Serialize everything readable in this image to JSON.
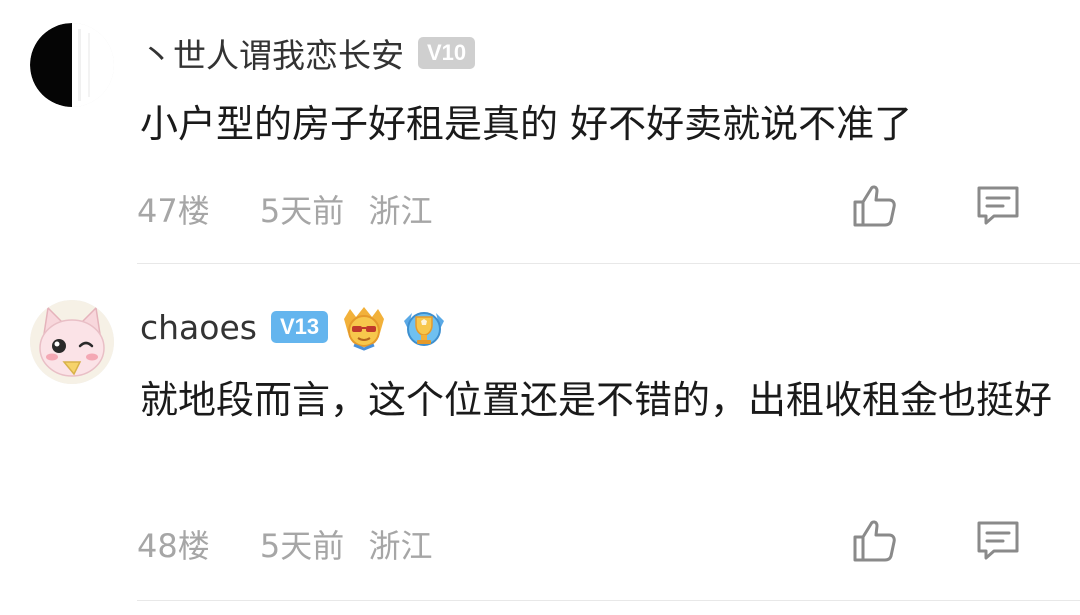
{
  "comments": [
    {
      "username": "丶世人谓我恋长安",
      "level": "V10",
      "content": "小户型的房子好租是真的 好不好卖就说不准了",
      "floor": "47楼",
      "time": "5天前",
      "location": "浙江",
      "avatar": "half-black-circle-avatar"
    },
    {
      "username": "chaoes",
      "level": "V13",
      "content": "就地段而言，这个位置还是不错的，出租收租金也挺好",
      "floor": "48楼",
      "time": "5天前",
      "location": "浙江",
      "avatar": "pink-cat-avatar",
      "medals": [
        "sunglasses-medal-icon",
        "trophy-medal-icon"
      ]
    }
  ],
  "colors": {
    "level_gray": "#cfcfcf",
    "level_blue": "#64b5ee",
    "meta_text": "#a6a6a6",
    "divider": "#e8e8e8"
  },
  "icons": [
    "thumbs-up-icon",
    "comment-icon"
  ]
}
